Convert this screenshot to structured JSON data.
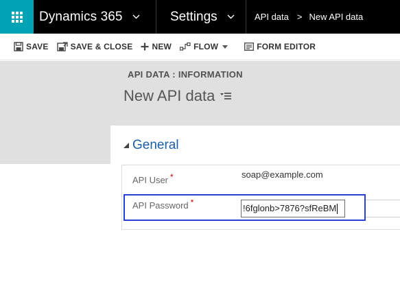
{
  "nav": {
    "app_name": "Dynamics 365",
    "area": "Settings",
    "breadcrumb": [
      "API data",
      "New API data"
    ],
    "accent_color": "#00a2b5"
  },
  "commands": {
    "save": "SAVE",
    "save_close": "SAVE & CLOSE",
    "new": "NEW",
    "flow": "FLOW",
    "form_editor": "FORM EDITOR"
  },
  "header": {
    "form_type": "API DATA : INFORMATION",
    "record_title": "New API data"
  },
  "section": {
    "title": "General",
    "title_color": "#1b5fa8"
  },
  "fields": {
    "api_user": {
      "label": "API User",
      "required_marker": "*",
      "value": "soap@example.com"
    },
    "api_password": {
      "label": "API Password",
      "required_marker": "*",
      "value": "!6fglonb>7876?sfReBM"
    }
  },
  "focus_color": "#2a3fd6",
  "icons": [
    "waffle-icon",
    "chevron-down-icon",
    "save-icon",
    "save-close-icon",
    "plus-icon",
    "flow-icon",
    "form-editor-icon",
    "title-menu-icon",
    "collapse-icon"
  ]
}
